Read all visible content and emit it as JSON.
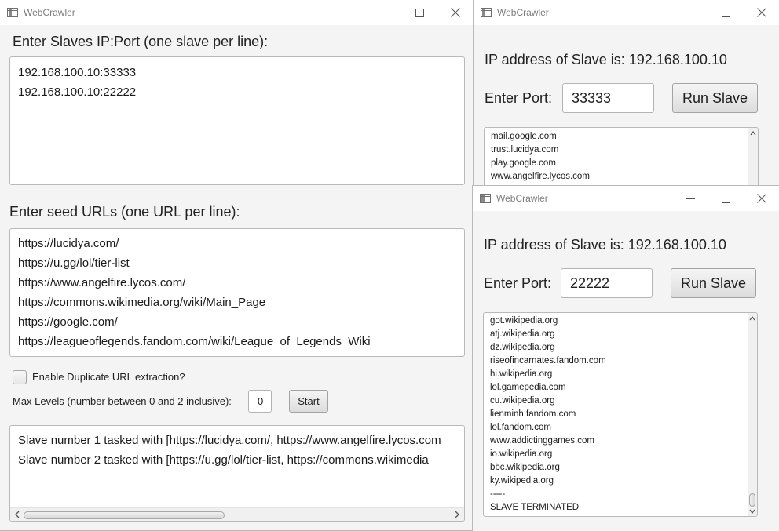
{
  "master": {
    "title": "WebCrawler",
    "slaves_label": "Enter Slaves IP:Port (one slave per line):",
    "slaves": [
      "192.168.100.10:33333",
      "192.168.100.10:22222"
    ],
    "seeds_label": "Enter seed URLs (one URL per line):",
    "seeds": [
      "https://lucidya.com/",
      "https://u.gg/lol/tier-list",
      "https://www.angelfire.lycos.com/",
      "https://commons.wikimedia.org/wiki/Main_Page",
      "https://google.com/",
      "https://leagueoflegends.fandom.com/wiki/League_of_Legends_Wiki"
    ],
    "duplicate_label": "Enable Duplicate URL extraction?",
    "duplicate_checked": false,
    "max_levels_label": "Max Levels (number between 0 and 2 inclusive):",
    "max_levels_value": "0",
    "start_label": "Start",
    "log": [
      "Slave number 1 tasked with [https://lucidya.com/, https://www.angelfire.lycos.com",
      "Slave number 2 tasked with [https://u.gg/lol/tier-list, https://commons.wikimedia"
    ]
  },
  "slave1": {
    "title": "WebCrawler",
    "ip_label": "IP address of Slave is: 192.168.100.10",
    "port_label": "Enter Port:",
    "port_value": "33333",
    "run_label": "Run Slave",
    "output": [
      "mail.google.com",
      "trust.lucidya.com",
      "play.google.com",
      "www.angelfire.lycos.com"
    ]
  },
  "slave2": {
    "title": "WebCrawler",
    "ip_label": "IP address of Slave is: 192.168.100.10",
    "port_label": "Enter Port:",
    "port_value": "22222",
    "run_label": "Run Slave",
    "output": [
      "got.wikipedia.org",
      "atj.wikipedia.org",
      "dz.wikipedia.org",
      "riseofincarnates.fandom.com",
      "hi.wikipedia.org",
      "lol.gamepedia.com",
      "cu.wikipedia.org",
      "lienminh.fandom.com",
      "lol.fandom.com",
      "www.addictinggames.com",
      "io.wikipedia.org",
      "bbc.wikipedia.org",
      "ky.wikipedia.org",
      " -----",
      "SLAVE TERMINATED"
    ]
  },
  "icons": {
    "app": "app-window-icon",
    "minimize": "minimize-icon",
    "maximize": "maximize-icon",
    "close": "close-icon"
  }
}
